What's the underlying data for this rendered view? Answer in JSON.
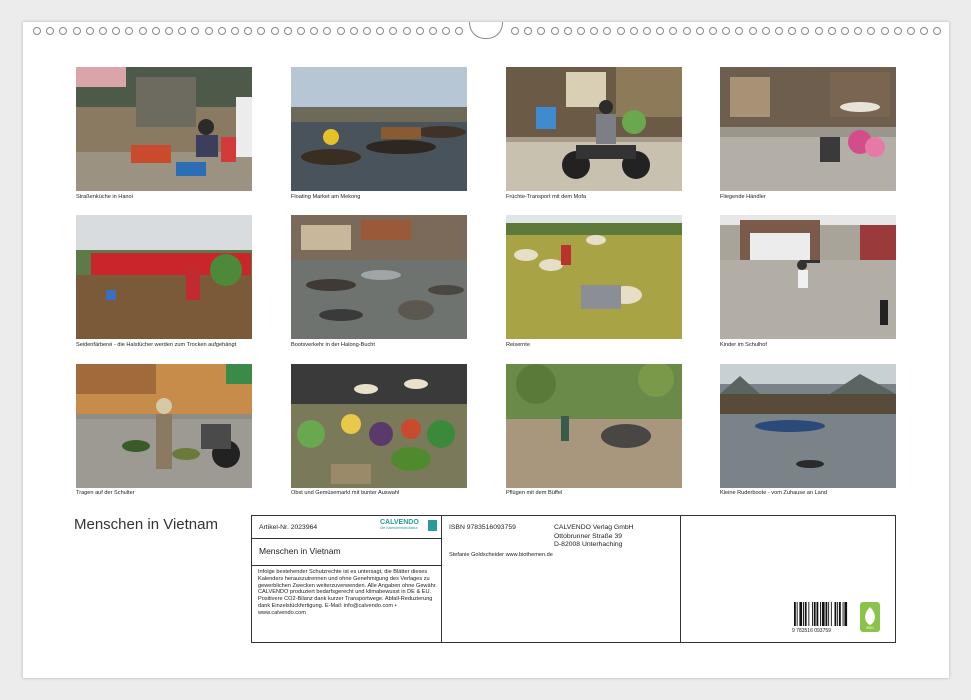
{
  "colors": {
    "accent": "#2a9a9a",
    "eco": "#8bc34a"
  },
  "captions": [
    "Straßenküche in Hanoi",
    "Floating Market am Mekong",
    "Früchte-Transport mit dem Mofa",
    "Fliegende Händler",
    "Seidenfärberei - die Halstücher werden zum Trocken aufgehängt",
    "Bootsverkehr in der Halong-Bucht",
    "Reisernte",
    "Kinder im Schulhof",
    "Tragen auf der Schulter",
    "Obst und Gemüsemarkt mit bunter Auswahl",
    "Pflügen mit dem Büffel",
    "Kleine Ruderboote - vom Zuhause an Land"
  ],
  "title": "Menschen in Vietnam",
  "info": {
    "article": "Artikel-Nr. 2023964",
    "brand": "CALVENDO",
    "brand_tag": "Die Kalendermanufaktur",
    "name": "Menschen in Vietnam",
    "legal": "Infolge bestehender Schutzrechte ist es untersagt, die Blätter dieses Kalenders herauszutrennen und ohne Genehmigung des Verlages zu gewerblichen Zwecken weiterzuverwenden. Alle Angaben ohne Gewähr. CALVENDO produziert bedarfsgerecht und klimabewusst in DE & EU. Positivere CO2-Bilanz dank kurzer Transportwege. Abfall-Reduzierung dank Einzelstückfertigung. E-Mail: info@calvendo.com • www.calvendo.com",
    "isbn": "ISBN 9783516093759",
    "publisher1": "CALVENDO Verlag GmbH",
    "publisher2": "Ottobrunner Straße 39",
    "publisher3": "D-82008 Unterhaching",
    "author": "Stefanie Goldscheider www.biothemen.de",
    "barcode_text": "9 783516 093759",
    "eco_label": "eco"
  }
}
